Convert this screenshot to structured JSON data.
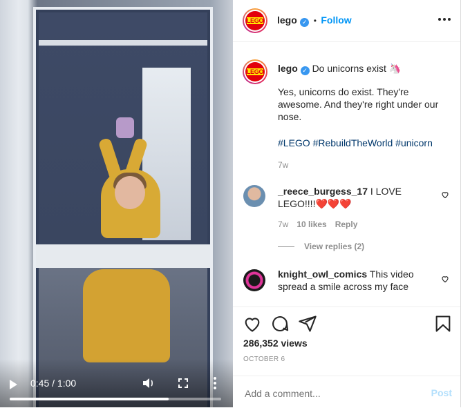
{
  "video": {
    "time": "0:45 / 1:00",
    "progress": 0.75
  },
  "header": {
    "username": "lego",
    "separator": "•",
    "follow_label": "Follow"
  },
  "caption": {
    "username": "lego",
    "title": "Do unicorns exist 🦄",
    "body": "Yes, unicorns do exist. They're awesome. And they're right under our nose.",
    "hashtags": "#LEGO #RebuildTheWorld #unicorn",
    "age": "7w"
  },
  "comments": [
    {
      "username": "_reece_burgess_17",
      "text": "I LOVE LEGO!!!!❤️❤️❤️",
      "age": "7w",
      "likes": "10 likes",
      "reply_label": "Reply",
      "view_replies": "View replies (2)"
    },
    {
      "username": "knight_owl_comics",
      "text": "This video spread a smile across my face"
    }
  ],
  "stats": {
    "views": "286,352 views",
    "date": "OCTOBER 6"
  },
  "add_comment": {
    "placeholder": "Add a comment...",
    "post_label": "Post"
  },
  "colors": {
    "link": "#0095f6",
    "hashtag": "#00376b",
    "muted": "#8e8e8e",
    "lego_red": "#e3000b"
  }
}
